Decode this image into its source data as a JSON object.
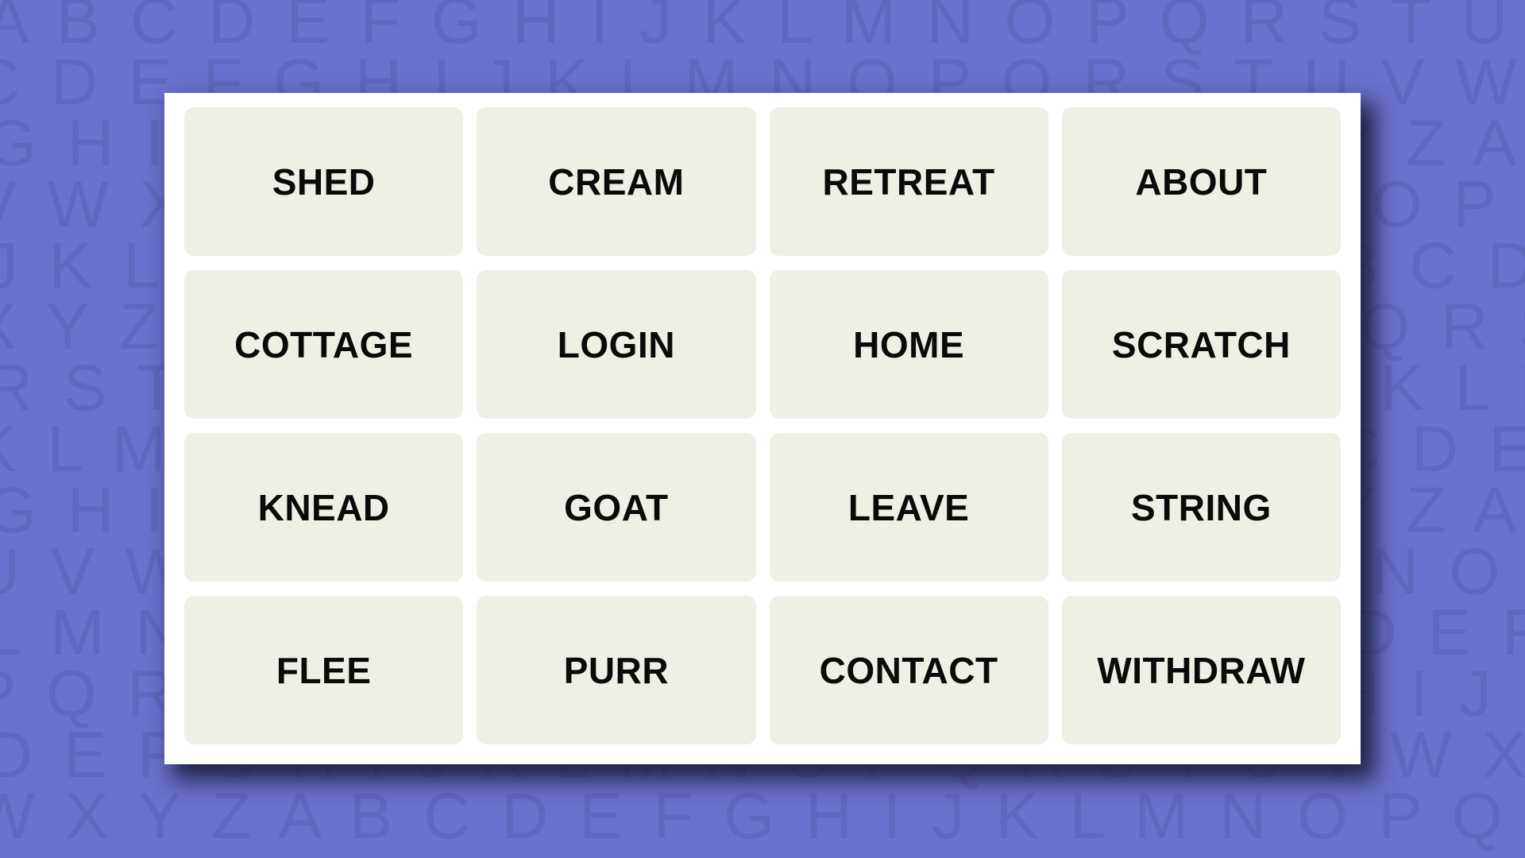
{
  "theme": {
    "background_color": "#6b71cc",
    "pattern_letter_color": "#6167bd",
    "card_color": "#ffffff",
    "tile_color": "#efefe6",
    "tile_text_color": "#0a0a0a",
    "shadow_color": "#252547"
  },
  "background": {
    "pattern_name": "alphabet-tile-pattern",
    "rows": [
      "A B C D E F G H I J K L M N O P Q R S T U V W X Y Z A B C D E F",
      "C D E F G H I J K L M N O P Q R S T U V W X Y Z A B C D E F G H",
      "G H I J K L M N O P Q R S T U V W X Y Z A B C D E F G H I J K L",
      "V W X Y Z A B C D E F G H I J K L M N O P Q R S T U V W X Y Z A",
      "J K L M N O P Q R S T U V W X Y Z A B C D E F G H I J K L M N O",
      "X Y Z A B C D E F G H I J K L M N O P Q R S T U V W X Y Z A B C",
      "R S T U V W X Y Z A B C D E F G H I J K L M N O P Q R S T U V W",
      "K L M N O P Q R S T U V W X Y Z A B C D E F G H I J K L M N O P",
      "G H I J K L M N O P Q R S T U V W X Y Z A B C D E F G H I J K L",
      "U V W X Y Z A B C D E F G H I J K L M N O P Q R S T U V W X Y Z",
      "L M N O P Q R S T U V W X Y Z A B C D E F G H I J K L M N O P Q",
      "P Q R S T U V W X Y Z A B C D E F G H I J K L M N O P Q R S T U",
      "D E F G H I J K L M N O P Q R S T U V W X Y Z A B C D E F G H I",
      "W X Y Z A B C D E F G H I J K L M N O P Q R S T U V W X Y Z A B"
    ]
  },
  "game": {
    "name": "word-grid",
    "rows": 4,
    "columns": 4,
    "tiles": [
      {
        "label": "SHED",
        "row": 1,
        "column": 1,
        "selected": false
      },
      {
        "label": "CREAM",
        "row": 1,
        "column": 2,
        "selected": false
      },
      {
        "label": "RETREAT",
        "row": 1,
        "column": 3,
        "selected": false
      },
      {
        "label": "ABOUT",
        "row": 1,
        "column": 4,
        "selected": false
      },
      {
        "label": "COTTAGE",
        "row": 2,
        "column": 1,
        "selected": false
      },
      {
        "label": "LOGIN",
        "row": 2,
        "column": 2,
        "selected": false
      },
      {
        "label": "HOME",
        "row": 2,
        "column": 3,
        "selected": false
      },
      {
        "label": "SCRATCH",
        "row": 2,
        "column": 4,
        "selected": false
      },
      {
        "label": "KNEAD",
        "row": 3,
        "column": 1,
        "selected": false
      },
      {
        "label": "GOAT",
        "row": 3,
        "column": 2,
        "selected": false
      },
      {
        "label": "LEAVE",
        "row": 3,
        "column": 3,
        "selected": false
      },
      {
        "label": "STRING",
        "row": 3,
        "column": 4,
        "selected": false
      },
      {
        "label": "FLEE",
        "row": 4,
        "column": 1,
        "selected": false
      },
      {
        "label": "PURR",
        "row": 4,
        "column": 2,
        "selected": false
      },
      {
        "label": "CONTACT",
        "row": 4,
        "column": 3,
        "selected": false
      },
      {
        "label": "WITHDRAW",
        "row": 4,
        "column": 4,
        "selected": false
      }
    ]
  }
}
